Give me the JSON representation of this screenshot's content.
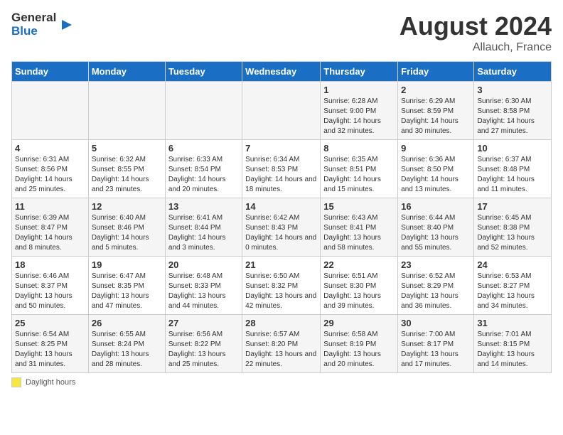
{
  "header": {
    "logo_general": "General",
    "logo_blue": "Blue",
    "month_year": "August 2024",
    "location": "Allauch, France"
  },
  "weekdays": [
    "Sunday",
    "Monday",
    "Tuesday",
    "Wednesday",
    "Thursday",
    "Friday",
    "Saturday"
  ],
  "legend_label": "Daylight hours",
  "weeks": [
    [
      {
        "day": "",
        "info": ""
      },
      {
        "day": "",
        "info": ""
      },
      {
        "day": "",
        "info": ""
      },
      {
        "day": "",
        "info": ""
      },
      {
        "day": "1",
        "info": "Sunrise: 6:28 AM\nSunset: 9:00 PM\nDaylight: 14 hours and 32 minutes."
      },
      {
        "day": "2",
        "info": "Sunrise: 6:29 AM\nSunset: 8:59 PM\nDaylight: 14 hours and 30 minutes."
      },
      {
        "day": "3",
        "info": "Sunrise: 6:30 AM\nSunset: 8:58 PM\nDaylight: 14 hours and 27 minutes."
      }
    ],
    [
      {
        "day": "4",
        "info": "Sunrise: 6:31 AM\nSunset: 8:56 PM\nDaylight: 14 hours and 25 minutes."
      },
      {
        "day": "5",
        "info": "Sunrise: 6:32 AM\nSunset: 8:55 PM\nDaylight: 14 hours and 23 minutes."
      },
      {
        "day": "6",
        "info": "Sunrise: 6:33 AM\nSunset: 8:54 PM\nDaylight: 14 hours and 20 minutes."
      },
      {
        "day": "7",
        "info": "Sunrise: 6:34 AM\nSunset: 8:53 PM\nDaylight: 14 hours and 18 minutes."
      },
      {
        "day": "8",
        "info": "Sunrise: 6:35 AM\nSunset: 8:51 PM\nDaylight: 14 hours and 15 minutes."
      },
      {
        "day": "9",
        "info": "Sunrise: 6:36 AM\nSunset: 8:50 PM\nDaylight: 14 hours and 13 minutes."
      },
      {
        "day": "10",
        "info": "Sunrise: 6:37 AM\nSunset: 8:48 PM\nDaylight: 14 hours and 11 minutes."
      }
    ],
    [
      {
        "day": "11",
        "info": "Sunrise: 6:39 AM\nSunset: 8:47 PM\nDaylight: 14 hours and 8 minutes."
      },
      {
        "day": "12",
        "info": "Sunrise: 6:40 AM\nSunset: 8:46 PM\nDaylight: 14 hours and 5 minutes."
      },
      {
        "day": "13",
        "info": "Sunrise: 6:41 AM\nSunset: 8:44 PM\nDaylight: 14 hours and 3 minutes."
      },
      {
        "day": "14",
        "info": "Sunrise: 6:42 AM\nSunset: 8:43 PM\nDaylight: 14 hours and 0 minutes."
      },
      {
        "day": "15",
        "info": "Sunrise: 6:43 AM\nSunset: 8:41 PM\nDaylight: 13 hours and 58 minutes."
      },
      {
        "day": "16",
        "info": "Sunrise: 6:44 AM\nSunset: 8:40 PM\nDaylight: 13 hours and 55 minutes."
      },
      {
        "day": "17",
        "info": "Sunrise: 6:45 AM\nSunset: 8:38 PM\nDaylight: 13 hours and 52 minutes."
      }
    ],
    [
      {
        "day": "18",
        "info": "Sunrise: 6:46 AM\nSunset: 8:37 PM\nDaylight: 13 hours and 50 minutes."
      },
      {
        "day": "19",
        "info": "Sunrise: 6:47 AM\nSunset: 8:35 PM\nDaylight: 13 hours and 47 minutes."
      },
      {
        "day": "20",
        "info": "Sunrise: 6:48 AM\nSunset: 8:33 PM\nDaylight: 13 hours and 44 minutes."
      },
      {
        "day": "21",
        "info": "Sunrise: 6:50 AM\nSunset: 8:32 PM\nDaylight: 13 hours and 42 minutes."
      },
      {
        "day": "22",
        "info": "Sunrise: 6:51 AM\nSunset: 8:30 PM\nDaylight: 13 hours and 39 minutes."
      },
      {
        "day": "23",
        "info": "Sunrise: 6:52 AM\nSunset: 8:29 PM\nDaylight: 13 hours and 36 minutes."
      },
      {
        "day": "24",
        "info": "Sunrise: 6:53 AM\nSunset: 8:27 PM\nDaylight: 13 hours and 34 minutes."
      }
    ],
    [
      {
        "day": "25",
        "info": "Sunrise: 6:54 AM\nSunset: 8:25 PM\nDaylight: 13 hours and 31 minutes."
      },
      {
        "day": "26",
        "info": "Sunrise: 6:55 AM\nSunset: 8:24 PM\nDaylight: 13 hours and 28 minutes."
      },
      {
        "day": "27",
        "info": "Sunrise: 6:56 AM\nSunset: 8:22 PM\nDaylight: 13 hours and 25 minutes."
      },
      {
        "day": "28",
        "info": "Sunrise: 6:57 AM\nSunset: 8:20 PM\nDaylight: 13 hours and 22 minutes."
      },
      {
        "day": "29",
        "info": "Sunrise: 6:58 AM\nSunset: 8:19 PM\nDaylight: 13 hours and 20 minutes."
      },
      {
        "day": "30",
        "info": "Sunrise: 7:00 AM\nSunset: 8:17 PM\nDaylight: 13 hours and 17 minutes."
      },
      {
        "day": "31",
        "info": "Sunrise: 7:01 AM\nSunset: 8:15 PM\nDaylight: 13 hours and 14 minutes."
      }
    ]
  ]
}
